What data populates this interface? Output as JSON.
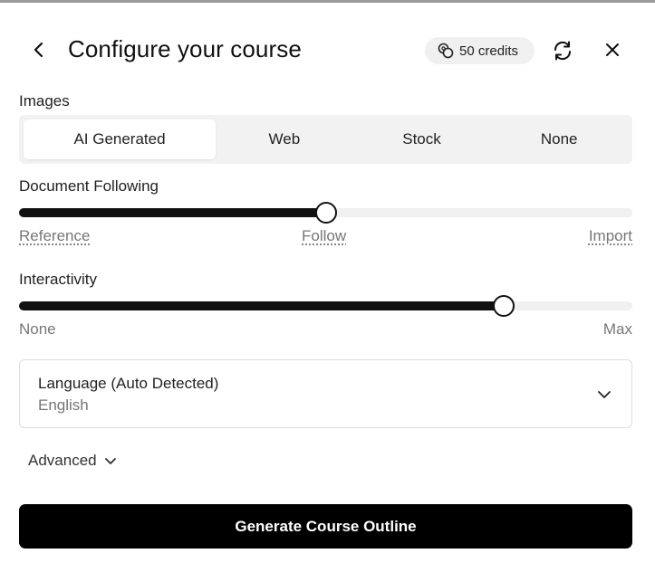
{
  "header": {
    "title": "Configure your course",
    "credits_label": "50 credits"
  },
  "images": {
    "label": "Images",
    "options": [
      "AI Generated",
      "Web",
      "Stock",
      "None"
    ],
    "selected": "AI Generated"
  },
  "document_following": {
    "label": "Document Following",
    "value_fraction": 0.5,
    "ticks": [
      "Reference",
      "Follow",
      "Import"
    ]
  },
  "interactivity": {
    "label": "Interactivity",
    "value_fraction": 0.79,
    "min_label": "None",
    "max_label": "Max"
  },
  "language": {
    "title": "Language (Auto Detected)",
    "value": "English"
  },
  "advanced_label": "Advanced",
  "generate_label": "Generate Course Outline",
  "colors": {
    "accent": "#000000",
    "track": "#f0f0f0"
  }
}
